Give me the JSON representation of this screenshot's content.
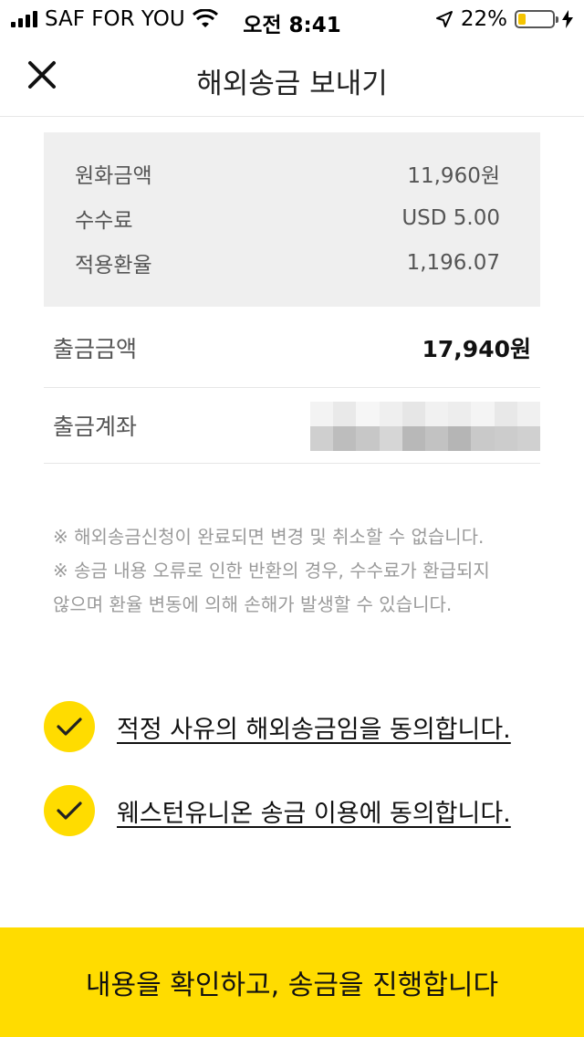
{
  "status_bar": {
    "carrier": "SAF FOR YOU",
    "time": "오전 8:41",
    "battery_pct": "22%",
    "battery_level": 0.22,
    "battery_color": "#f5c400"
  },
  "header": {
    "title": "해외송금 보내기",
    "close_icon": "close-icon"
  },
  "rate_box": {
    "rows": [
      {
        "label": "원화금액",
        "value": "11,960원"
      },
      {
        "label": "수수료",
        "value": "USD 5.00"
      },
      {
        "label": "적용환율",
        "value": "1,196.07"
      }
    ]
  },
  "details": {
    "withdraw_amount_label": "출금금액",
    "withdraw_amount_value": "17,940원",
    "withdraw_account_label": "출금계좌"
  },
  "notices": [
    "※ 해외송금신청이 완료되면 변경 및 취소할 수 없습니다.",
    "※ 송금 내용 오류로 인한 반환의 경우, 수수료가 환급되지",
    "않으며 환율 변동에 의해 손해가 발생할 수 있습니다."
  ],
  "agreements": [
    {
      "label": "적정 사유의 해외송금임을 동의합니다.",
      "checked": true
    },
    {
      "label": "웨스턴유니온 송금 이용에 동의합니다.",
      "checked": true
    }
  ],
  "cta": {
    "label": "내용을 확인하고, 송금을 진행합니다",
    "color": "#ffdc00"
  }
}
